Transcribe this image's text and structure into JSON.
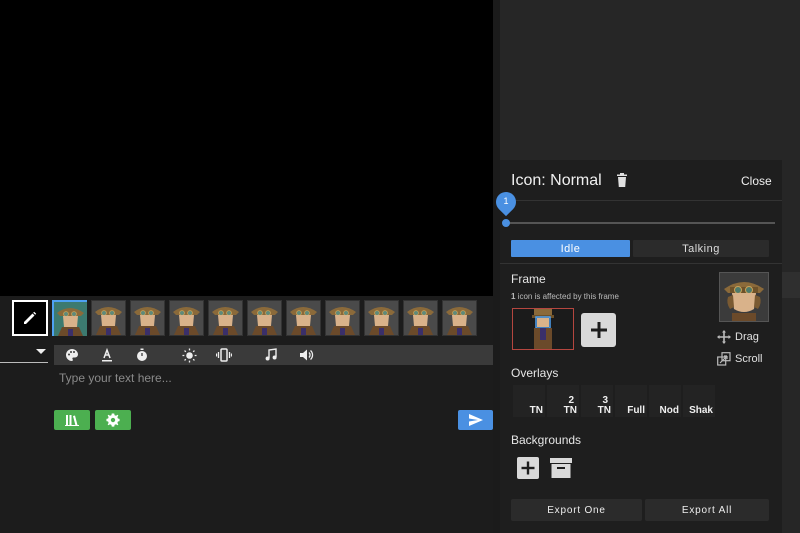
{
  "composer": {
    "placeholder": "Type your text here...",
    "toolbar_icons": [
      "palette-icon",
      "text-color-icon",
      "timer-icon",
      "brightness-icon",
      "vibrate-icon",
      "music-note-icon",
      "volume-icon"
    ],
    "thumbnail_count": 11
  },
  "panel": {
    "title": "Icon: Normal",
    "close_label": "Close",
    "slider_value": "1",
    "tabs": [
      "Idle",
      "Talking"
    ],
    "frame": {
      "heading": "Frame",
      "note_count": "1",
      "note_text": "icon is affected by this frame"
    },
    "actions": {
      "drag_label": "Drag",
      "scroll_label": "Scroll"
    },
    "overlays": {
      "heading": "Overlays",
      "items": [
        {
          "num": "",
          "label": "TN"
        },
        {
          "num": "2",
          "label": "TN"
        },
        {
          "num": "3",
          "label": "TN"
        },
        {
          "num": "",
          "label": "Full"
        },
        {
          "num": "",
          "label": "Nod"
        },
        {
          "num": "",
          "label": "Shak"
        }
      ]
    },
    "backgrounds": {
      "heading": "Backgrounds"
    },
    "export_one": "Export One",
    "export_all": "Export All"
  },
  "colors": {
    "accent": "#4a90e2",
    "green": "#4caf50",
    "frame_border": "#b5463f"
  }
}
